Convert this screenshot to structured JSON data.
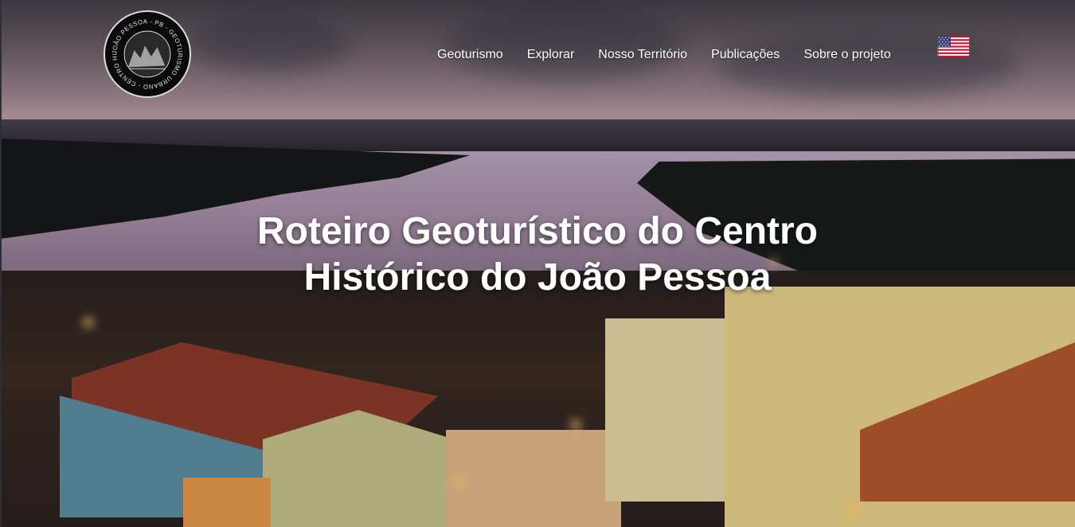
{
  "header": {
    "logo": {
      "icon": "city-seal-logo",
      "text": "JOÃO PESSOA - PB - GEOTURISMO URBANO - CENTRO HISTÓRICO"
    },
    "nav": [
      {
        "label": "Geoturismo"
      },
      {
        "label": "Explorar"
      },
      {
        "label": "Nosso Território"
      },
      {
        "label": "Publicações"
      },
      {
        "label": "Sobre o projeto"
      }
    ],
    "language_toggle": {
      "icon": "us-flag-icon"
    }
  },
  "hero": {
    "title_line1": "Roteiro Geoturístico do Centro",
    "title_line2": "Histórico do João Pessoa"
  },
  "colors": {
    "nav_text": "#ffffff",
    "title_text": "#ffffff"
  }
}
